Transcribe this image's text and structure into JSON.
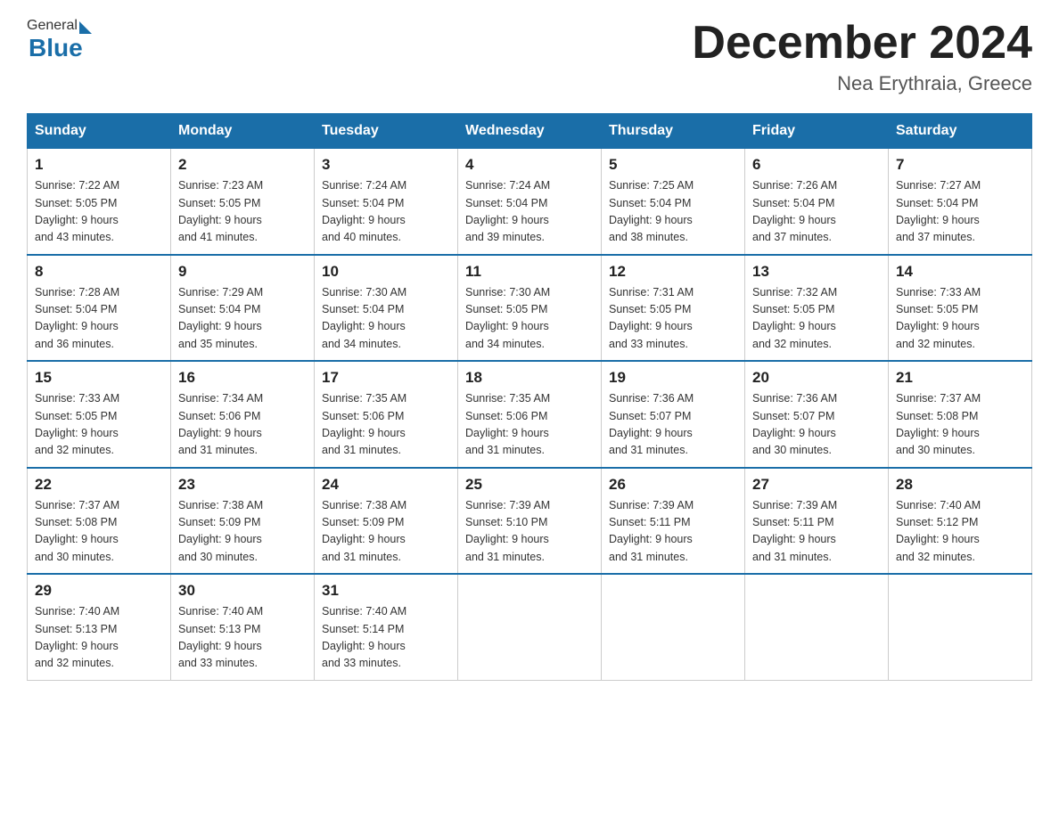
{
  "header": {
    "logo_general": "General",
    "logo_blue": "Blue",
    "month_title": "December 2024",
    "location": "Nea Erythraia, Greece"
  },
  "days_of_week": [
    "Sunday",
    "Monday",
    "Tuesday",
    "Wednesday",
    "Thursday",
    "Friday",
    "Saturday"
  ],
  "weeks": [
    [
      {
        "date": "1",
        "sunrise": "7:22 AM",
        "sunset": "5:05 PM",
        "daylight": "9 hours and 43 minutes."
      },
      {
        "date": "2",
        "sunrise": "7:23 AM",
        "sunset": "5:05 PM",
        "daylight": "9 hours and 41 minutes."
      },
      {
        "date": "3",
        "sunrise": "7:24 AM",
        "sunset": "5:04 PM",
        "daylight": "9 hours and 40 minutes."
      },
      {
        "date": "4",
        "sunrise": "7:24 AM",
        "sunset": "5:04 PM",
        "daylight": "9 hours and 39 minutes."
      },
      {
        "date": "5",
        "sunrise": "7:25 AM",
        "sunset": "5:04 PM",
        "daylight": "9 hours and 38 minutes."
      },
      {
        "date": "6",
        "sunrise": "7:26 AM",
        "sunset": "5:04 PM",
        "daylight": "9 hours and 37 minutes."
      },
      {
        "date": "7",
        "sunrise": "7:27 AM",
        "sunset": "5:04 PM",
        "daylight": "9 hours and 37 minutes."
      }
    ],
    [
      {
        "date": "8",
        "sunrise": "7:28 AM",
        "sunset": "5:04 PM",
        "daylight": "9 hours and 36 minutes."
      },
      {
        "date": "9",
        "sunrise": "7:29 AM",
        "sunset": "5:04 PM",
        "daylight": "9 hours and 35 minutes."
      },
      {
        "date": "10",
        "sunrise": "7:30 AM",
        "sunset": "5:04 PM",
        "daylight": "9 hours and 34 minutes."
      },
      {
        "date": "11",
        "sunrise": "7:30 AM",
        "sunset": "5:05 PM",
        "daylight": "9 hours and 34 minutes."
      },
      {
        "date": "12",
        "sunrise": "7:31 AM",
        "sunset": "5:05 PM",
        "daylight": "9 hours and 33 minutes."
      },
      {
        "date": "13",
        "sunrise": "7:32 AM",
        "sunset": "5:05 PM",
        "daylight": "9 hours and 32 minutes."
      },
      {
        "date": "14",
        "sunrise": "7:33 AM",
        "sunset": "5:05 PM",
        "daylight": "9 hours and 32 minutes."
      }
    ],
    [
      {
        "date": "15",
        "sunrise": "7:33 AM",
        "sunset": "5:05 PM",
        "daylight": "9 hours and 32 minutes."
      },
      {
        "date": "16",
        "sunrise": "7:34 AM",
        "sunset": "5:06 PM",
        "daylight": "9 hours and 31 minutes."
      },
      {
        "date": "17",
        "sunrise": "7:35 AM",
        "sunset": "5:06 PM",
        "daylight": "9 hours and 31 minutes."
      },
      {
        "date": "18",
        "sunrise": "7:35 AM",
        "sunset": "5:06 PM",
        "daylight": "9 hours and 31 minutes."
      },
      {
        "date": "19",
        "sunrise": "7:36 AM",
        "sunset": "5:07 PM",
        "daylight": "9 hours and 31 minutes."
      },
      {
        "date": "20",
        "sunrise": "7:36 AM",
        "sunset": "5:07 PM",
        "daylight": "9 hours and 30 minutes."
      },
      {
        "date": "21",
        "sunrise": "7:37 AM",
        "sunset": "5:08 PM",
        "daylight": "9 hours and 30 minutes."
      }
    ],
    [
      {
        "date": "22",
        "sunrise": "7:37 AM",
        "sunset": "5:08 PM",
        "daylight": "9 hours and 30 minutes."
      },
      {
        "date": "23",
        "sunrise": "7:38 AM",
        "sunset": "5:09 PM",
        "daylight": "9 hours and 30 minutes."
      },
      {
        "date": "24",
        "sunrise": "7:38 AM",
        "sunset": "5:09 PM",
        "daylight": "9 hours and 31 minutes."
      },
      {
        "date": "25",
        "sunrise": "7:39 AM",
        "sunset": "5:10 PM",
        "daylight": "9 hours and 31 minutes."
      },
      {
        "date": "26",
        "sunrise": "7:39 AM",
        "sunset": "5:11 PM",
        "daylight": "9 hours and 31 minutes."
      },
      {
        "date": "27",
        "sunrise": "7:39 AM",
        "sunset": "5:11 PM",
        "daylight": "9 hours and 31 minutes."
      },
      {
        "date": "28",
        "sunrise": "7:40 AM",
        "sunset": "5:12 PM",
        "daylight": "9 hours and 32 minutes."
      }
    ],
    [
      {
        "date": "29",
        "sunrise": "7:40 AM",
        "sunset": "5:13 PM",
        "daylight": "9 hours and 32 minutes."
      },
      {
        "date": "30",
        "sunrise": "7:40 AM",
        "sunset": "5:13 PM",
        "daylight": "9 hours and 33 minutes."
      },
      {
        "date": "31",
        "sunrise": "7:40 AM",
        "sunset": "5:14 PM",
        "daylight": "9 hours and 33 minutes."
      },
      null,
      null,
      null,
      null
    ]
  ],
  "labels": {
    "sunrise": "Sunrise:",
    "sunset": "Sunset:",
    "daylight": "Daylight:"
  }
}
